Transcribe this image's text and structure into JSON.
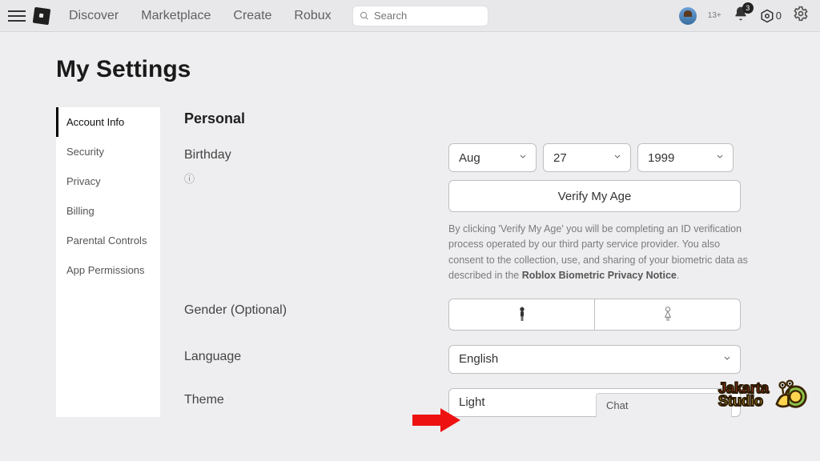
{
  "nav": {
    "links": [
      "Discover",
      "Marketplace",
      "Create",
      "Robux"
    ],
    "search_placeholder": "Search",
    "age_label": "13+",
    "notif_count": "3",
    "robux_count": "0"
  },
  "page_title": "My Settings",
  "sidebar": {
    "items": [
      {
        "label": "Account Info"
      },
      {
        "label": "Security"
      },
      {
        "label": "Privacy"
      },
      {
        "label": "Billing"
      },
      {
        "label": "Parental Controls"
      },
      {
        "label": "App Permissions"
      }
    ],
    "active_index": 0
  },
  "section": {
    "title": "Personal",
    "birthday": {
      "label": "Birthday",
      "help_icon": "?",
      "month": "Aug",
      "day": "27",
      "year": "1999",
      "verify_button": "Verify My Age",
      "disclaimer_pre": "By clicking 'Verify My Age' you will be completing an ID verification process operated by our third party service provider. You also consent to the collection, use, and sharing of your biometric data as described in the ",
      "disclaimer_link": "Roblox Biometric Privacy Notice",
      "disclaimer_post": "."
    },
    "gender": {
      "label": "Gender (Optional)"
    },
    "language": {
      "label": "Language",
      "value": "English"
    },
    "theme": {
      "label": "Theme",
      "value": "Light"
    }
  },
  "chat_tab": "Chat",
  "watermark": {
    "line1": "Jakarta",
    "line2": "Studio"
  }
}
